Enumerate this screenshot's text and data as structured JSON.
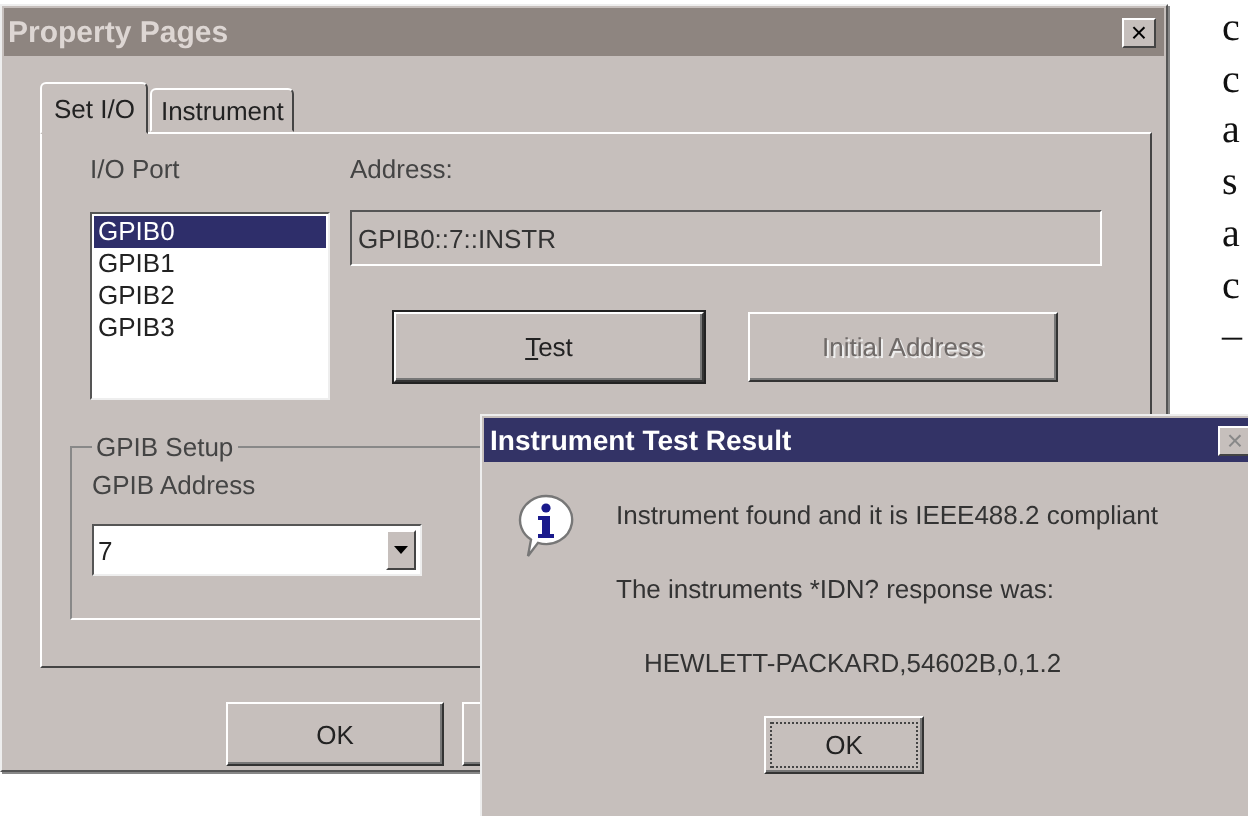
{
  "window": {
    "title": "Property Pages",
    "close_glyph": "×"
  },
  "tabs": [
    {
      "label": "Set I/O",
      "selected": true
    },
    {
      "label": "Instrument",
      "selected": false
    }
  ],
  "io_port": {
    "label": "I/O Port",
    "items": [
      {
        "label": "GPIB0",
        "selected": true
      },
      {
        "label": "GPIB1",
        "selected": false
      },
      {
        "label": "GPIB2",
        "selected": false
      },
      {
        "label": "GPIB3",
        "selected": false
      }
    ]
  },
  "address": {
    "label": "Address:",
    "value": "GPIB0::7::INSTR"
  },
  "buttons": [
    {
      "label": "Test",
      "first_letter_underlined": true,
      "disabled": false
    },
    {
      "label": "Initial Address",
      "disabled": true
    }
  ],
  "gpib_setup": {
    "title": "GPIB Setup",
    "field_label": "GPIB Address",
    "value": "7"
  },
  "footer_buttons": [
    {
      "label": "OK"
    }
  ],
  "dialog": {
    "title": "Instrument Test Result",
    "close_glyph": "×",
    "close_disabled": true,
    "lines": [
      "Instrument found and it is IEEE488.2 compliant",
      "The instruments *IDN? response was:",
      "HEWLETT-PACKARD,54602B,0,1.2"
    ],
    "button": "OK"
  },
  "margin_text": [
    "c",
    "c",
    "a",
    "s",
    "a",
    "c",
    "–"
  ]
}
